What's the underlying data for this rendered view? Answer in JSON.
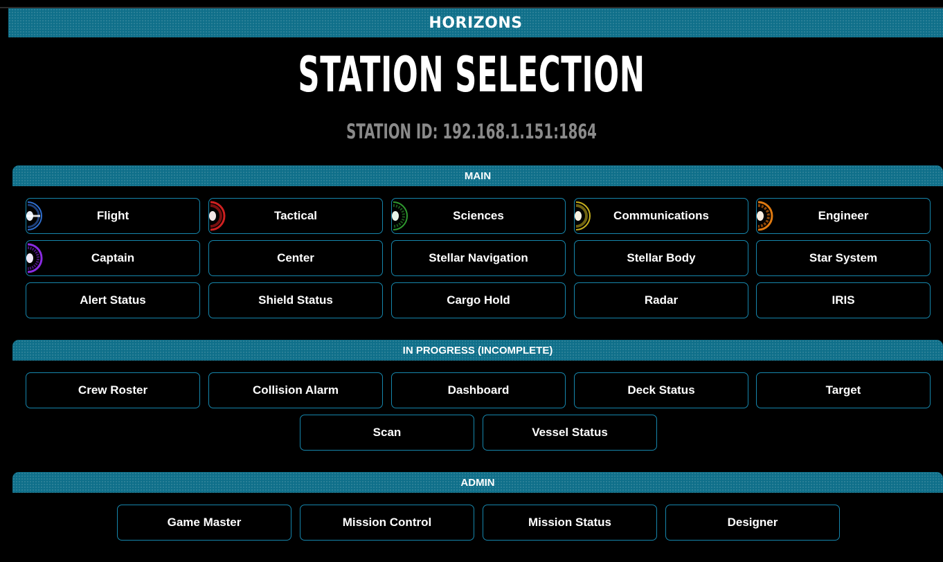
{
  "app_title": "HORIZONS",
  "page_title": "STATION SELECTION",
  "station_id": "STATION ID: 192.168.1.151:1864",
  "sections": {
    "main": {
      "label": "MAIN",
      "buttons": [
        {
          "label": "Flight",
          "icon": "flight-icon",
          "icon_color": "#2f6fd0"
        },
        {
          "label": "Tactical",
          "icon": "tactical-icon",
          "icon_color": "#d02020"
        },
        {
          "label": "Sciences",
          "icon": "sciences-icon",
          "icon_color": "#2f9a2f"
        },
        {
          "label": "Communications",
          "icon": "communications-icon",
          "icon_color": "#c8b21e"
        },
        {
          "label": "Engineer",
          "icon": "engineer-icon",
          "icon_color": "#e07a10"
        },
        {
          "label": "Captain",
          "icon": "captain-icon",
          "icon_color": "#8a2be2"
        },
        {
          "label": "Center"
        },
        {
          "label": "Stellar Navigation"
        },
        {
          "label": "Stellar Body"
        },
        {
          "label": "Star System"
        },
        {
          "label": "Alert Status"
        },
        {
          "label": "Shield Status"
        },
        {
          "label": "Cargo Hold"
        },
        {
          "label": "Radar"
        },
        {
          "label": "IRIS"
        }
      ]
    },
    "in_progress": {
      "label": "IN PROGRESS (INCOMPLETE)",
      "buttons": [
        {
          "label": "Crew Roster"
        },
        {
          "label": "Collision Alarm"
        },
        {
          "label": "Dashboard"
        },
        {
          "label": "Deck Status"
        },
        {
          "label": "Target"
        },
        {
          "label": "Scan"
        },
        {
          "label": "Vessel Status"
        }
      ]
    },
    "admin": {
      "label": "ADMIN",
      "buttons": [
        {
          "label": "Game Master"
        },
        {
          "label": "Mission Control"
        },
        {
          "label": "Mission Status"
        },
        {
          "label": "Designer"
        }
      ]
    }
  },
  "colors": {
    "accent": "#0f6f8a",
    "button_border": "#1687ad",
    "background": "#000000",
    "station_id_text": "#8a8a8a"
  }
}
